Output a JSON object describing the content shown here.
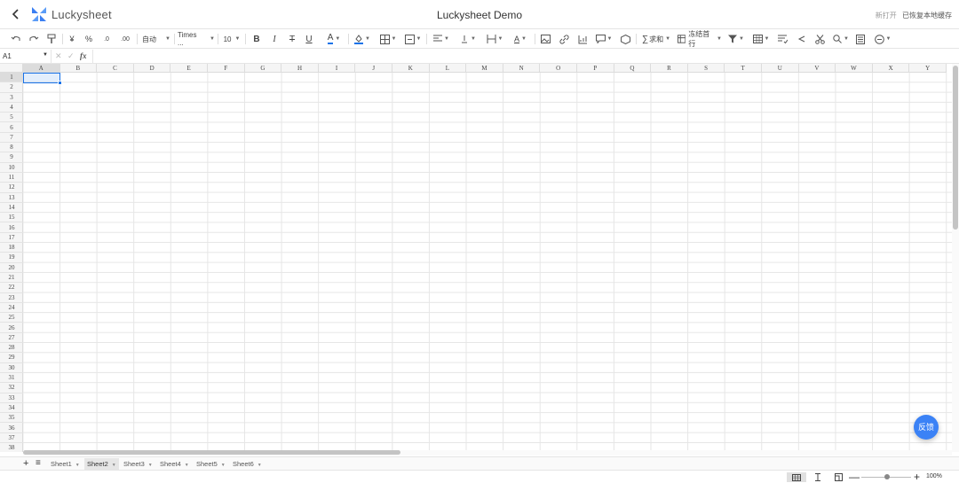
{
  "header": {
    "logo_text": "Luckysheet",
    "title": "Luckysheet Demo",
    "new_open": "新打开",
    "saved_status": "已恢复本地缓存"
  },
  "toolbar": {
    "currency": "¥",
    "percent": "%",
    "dec_less": ".0",
    "dec_more": ".00",
    "format": "自动",
    "font": "Times ...",
    "font_size": "10",
    "bold": "B",
    "italic": "I",
    "strike": "T",
    "underline": "U",
    "text_color_glyph": "A",
    "text_color": "#1a73e8",
    "fill_color": "#1a73e8",
    "sum": "求和",
    "freeze": "冻结首行"
  },
  "formula_bar": {
    "cell_ref": "A1",
    "fx": "fx",
    "value": ""
  },
  "grid": {
    "columns": [
      "A",
      "B",
      "C",
      "D",
      "E",
      "F",
      "G",
      "H",
      "I",
      "J",
      "K",
      "L",
      "M",
      "N",
      "O",
      "P",
      "Q",
      "R",
      "S",
      "T",
      "U",
      "V",
      "W",
      "X",
      "Y"
    ],
    "rows": [
      "1",
      "2",
      "3",
      "4",
      "5",
      "6",
      "7",
      "8",
      "9",
      "10",
      "11",
      "12",
      "13",
      "14",
      "15",
      "16",
      "17",
      "18",
      "19",
      "20",
      "21",
      "22",
      "23",
      "24",
      "25",
      "26",
      "27",
      "28",
      "29",
      "30",
      "31",
      "32",
      "33",
      "34",
      "35",
      "36",
      "37",
      "38"
    ],
    "selected_cell": "A1"
  },
  "feedback_label": "反馈",
  "sheets": [
    "Sheet1",
    "Sheet2",
    "Sheet3",
    "Sheet4",
    "Sheet5",
    "Sheet6"
  ],
  "active_sheet": "Sheet2",
  "status": {
    "zoom": "100%"
  },
  "colors": {
    "accent": "#1a73e8",
    "feedback": "#3b82f6",
    "logo": "#3b7ff2"
  }
}
